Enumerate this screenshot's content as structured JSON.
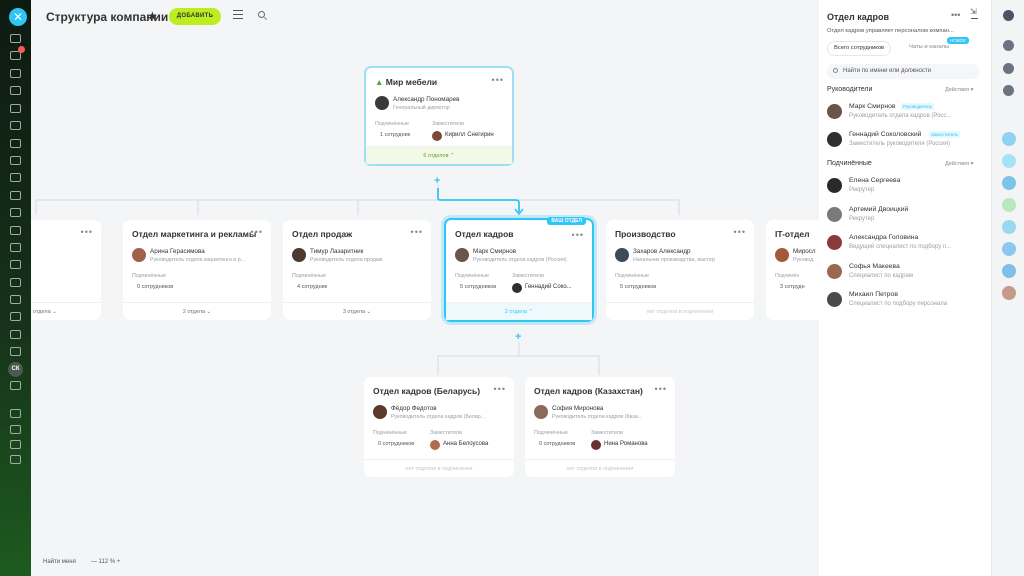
{
  "rail": {
    "close_label": "✕",
    "avatar_initials": "СК"
  },
  "header": {
    "title": "Структура компании",
    "add_label": "ДОБАВИТЬ"
  },
  "root": {
    "title": "Мир мебели",
    "head_name": "Александр Пономарев",
    "head_role": "Генеральный директор",
    "sub_label": "Подчинённые",
    "dep_label": "Заместители",
    "sub_count": "1 сотрудник",
    "deputy": "Кирилл Снегирин",
    "footer": "6 отделов"
  },
  "departments": [
    {
      "title": "Отдел маркетинга и рекламы",
      "head_name": "Арина Герасимова",
      "head_role": "Руководитель отдела маркетинга и р...",
      "sub_label": "Подчинённые",
      "sub_count": "0 сотрудников",
      "footer": "2 отдела"
    },
    {
      "title": "Отдел продаж",
      "head_name": "Тимур Лазаритник",
      "head_role": "Руководитель отдела продаж",
      "sub_label": "Подчинённые",
      "sub_count": "4 сотрудник",
      "footer": "3 отдела"
    },
    {
      "title": "Отдел кадров",
      "tag": "ВАШ ОТДЕЛ",
      "head_name": "Марк Смирнов",
      "head_role": "Руководитель отдела кадров (Россия)",
      "sub_label": "Подчинённые",
      "dep_label": "Заместители",
      "sub_count": "5 сотрудников",
      "deputy": "Геннадий Соко...",
      "footer": "2 отдела"
    },
    {
      "title": "Производство",
      "head_name": "Захаров Александр",
      "head_role": "Начальник производства, мастер",
      "sub_label": "Подчинённые",
      "sub_count": "5 сотрудников",
      "footer": "нет отделов в подчинении"
    },
    {
      "title": "IT-отдел",
      "head_name": "Миросл",
      "head_role": "Руковод",
      "sub_label": "Подчинён",
      "sub_count": "3 сотрудн",
      "footer": ""
    }
  ],
  "left_partial": {
    "footer": "отдела"
  },
  "children": [
    {
      "title": "Отдел кадров (Беларусь)",
      "head_name": "Фёдор Федотов",
      "head_role": "Руководитель отдела кадров (Белар...",
      "sub_label": "Подчинённые",
      "dep_label": "Заместители",
      "sub_count": "0 сотрудников",
      "deputy": "Анна Белоусова",
      "footer": "нет отделов в подчинении"
    },
    {
      "title": "Отдел кадров (Казахстан)",
      "head_name": "София Миронова",
      "head_role": "Руководитель отдела кадров (Каза...",
      "sub_label": "Подчинённые",
      "dep_label": "Заместители",
      "sub_count": "0 сотрудников",
      "deputy": "Нина Романова",
      "footer": "нет отделов в подчинении"
    }
  ],
  "bottom": {
    "find_me": "Найти меня",
    "zoom": "— 112 % +"
  },
  "panel": {
    "title": "Отдел кадров",
    "description": "Отдел кадров управляет персоналом компан...",
    "tab_all": "Всего сотрудников",
    "tab_chats": "Чаты и каналы",
    "tab_new": "НОВОЕ",
    "search_placeholder": "Найти по имени или должности",
    "heads_label": "Руководители",
    "subs_label": "Подчинённые",
    "actions_label": "Действия",
    "heads": [
      {
        "name": "Марк Смирнов",
        "role": "Руководитель отдела кадров (Росс...",
        "tag": "Руководитель"
      },
      {
        "name": "Геннадий Соколовский",
        "role": "Заместитель руководителя (Россия)",
        "tag": "Заместитель"
      }
    ],
    "subs": [
      {
        "name": "Елена Сергеева",
        "role": "Рекрутер"
      },
      {
        "name": "Артемий Двоицкий",
        "role": "Рекрутер"
      },
      {
        "name": "Александра Головина",
        "role": "Ведущий специалист по подбору п..."
      },
      {
        "name": "Софья Макеева",
        "role": "Специалист по кадрам"
      },
      {
        "name": "Михаил Петров",
        "role": "Специалист по подбору персонала"
      }
    ]
  },
  "colors": {
    "accent": "#2fc6f6",
    "add_button": "#bbed21"
  }
}
